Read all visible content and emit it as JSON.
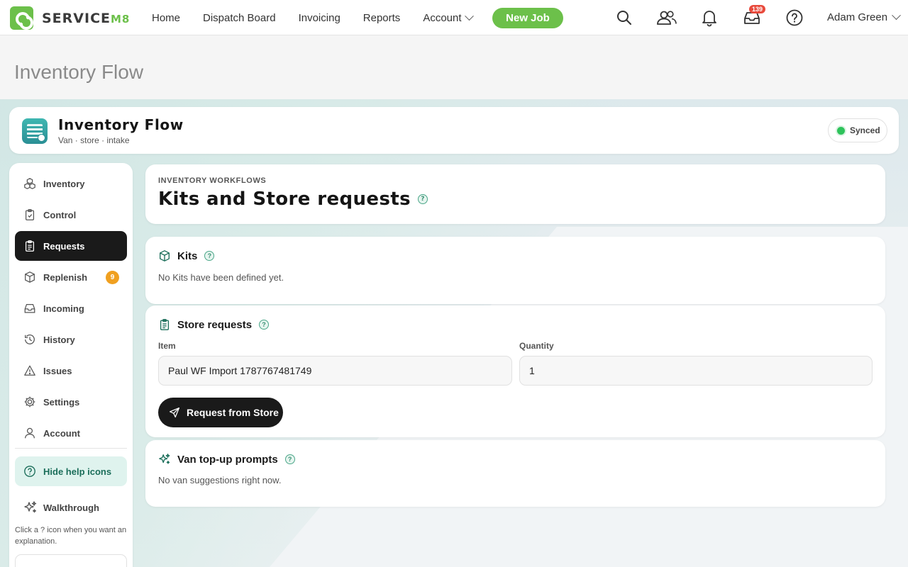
{
  "topnav": {
    "brand": "SERVICE",
    "brand_suffix": "M8",
    "links": [
      "Home",
      "Dispatch Board",
      "Invoicing",
      "Reports",
      "Account"
    ],
    "new_job": "New Job",
    "inbox_badge": "139",
    "user": "Adam Green",
    "icons": [
      "search-icon",
      "people-icon",
      "bell-icon",
      "inbox-icon",
      "help-icon"
    ]
  },
  "page": {
    "title": "Inventory Flow"
  },
  "app": {
    "title": "Inventory Flow",
    "subtitle": "Van · store · intake",
    "status": "Synced",
    "status_color": "#2ec35b"
  },
  "sidebar": {
    "items": [
      {
        "label": "Inventory",
        "icon": "boxes-icon"
      },
      {
        "label": "Control",
        "icon": "clipboard-check-icon"
      },
      {
        "label": "Requests",
        "icon": "clipboard-list-icon",
        "active": true
      },
      {
        "label": "Replenish",
        "icon": "package-icon",
        "badge": "9"
      },
      {
        "label": "Incoming",
        "icon": "inbox-icon"
      },
      {
        "label": "History",
        "icon": "history-icon"
      },
      {
        "label": "Issues",
        "icon": "warning-icon"
      },
      {
        "label": "Settings",
        "icon": "gear-icon"
      },
      {
        "label": "Account",
        "icon": "user-icon"
      }
    ],
    "help_toggle": "Hide help icons",
    "walkthrough": "Walkthrough",
    "walk_hint": "Click a ? icon when you want an explanation."
  },
  "main": {
    "eyebrow": "INVENTORY WORKFLOWS",
    "title": "Kits and Store requests",
    "kits": {
      "title": "Kits",
      "empty": "No Kits have been defined yet."
    },
    "store_requests": {
      "title": "Store requests",
      "item_label": "Item",
      "item_value": "Paul WF Import 1787767481749",
      "quantity_label": "Quantity",
      "quantity_value": "1",
      "button": "Request from Store"
    },
    "van": {
      "title": "Van top-up prompts",
      "empty": "No van suggestions right now."
    }
  },
  "colors": {
    "accent": "#6cc04a",
    "dark": "#1a1a1a",
    "badge": "#f0a020",
    "alert": "#e84a3c"
  }
}
